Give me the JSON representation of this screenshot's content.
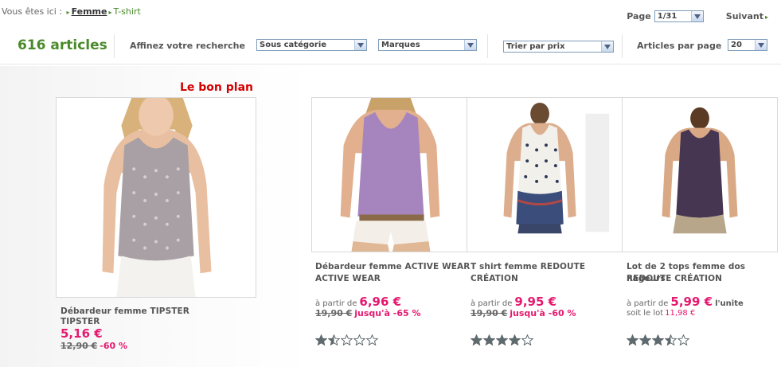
{
  "breadcrumb": {
    "prefix": "Vous êtes ici :",
    "link": "Femme",
    "current": "T-shirt"
  },
  "pagination": {
    "label": "Page",
    "value": "1/31",
    "next": "Suivant"
  },
  "toolbar": {
    "count": "616 articles",
    "refine_label": "Affinez votre recherche",
    "subcategory": "Sous catégorie",
    "brands": "Marques",
    "sort": "Trier par prix",
    "per_page_label": "Articles par page",
    "per_page_value": "20"
  },
  "featured_label": "Le bon plan",
  "colors": {
    "accent_green": "#4a8a2a",
    "price_pink": "#e5196f",
    "promo_red": "#d40000"
  },
  "products": [
    {
      "name": "Débardeur femme TIPSTER",
      "brand": "TIPSTER",
      "price": "5,16 €",
      "old_price": "12,90 €",
      "discount": "-60 %"
    },
    {
      "name": "Débardeur femme ACTIVE WEAR",
      "brand": "ACTIVE WEAR",
      "from": "à partir de",
      "price": "6,96 €",
      "old_price": "19,90 €",
      "discount": "jusqu'à -65 %",
      "rating": 1.5
    },
    {
      "name": "T shirt femme REDOUTE",
      "brand": "CRÉATION",
      "from": "à partir de",
      "price": "9,95 €",
      "old_price": "19,90 €",
      "discount": "jusqu'à -60 %",
      "rating": 4
    },
    {
      "name": "Lot de 2 tops femme dos nageurs",
      "brand": "REDOUTE CRÉATION",
      "from": "à partir de",
      "price": "5,99 €",
      "unit": "l'unite",
      "lot_label": "soit le lot",
      "lot_price": "11,98 €",
      "rating": 3.5
    }
  ]
}
